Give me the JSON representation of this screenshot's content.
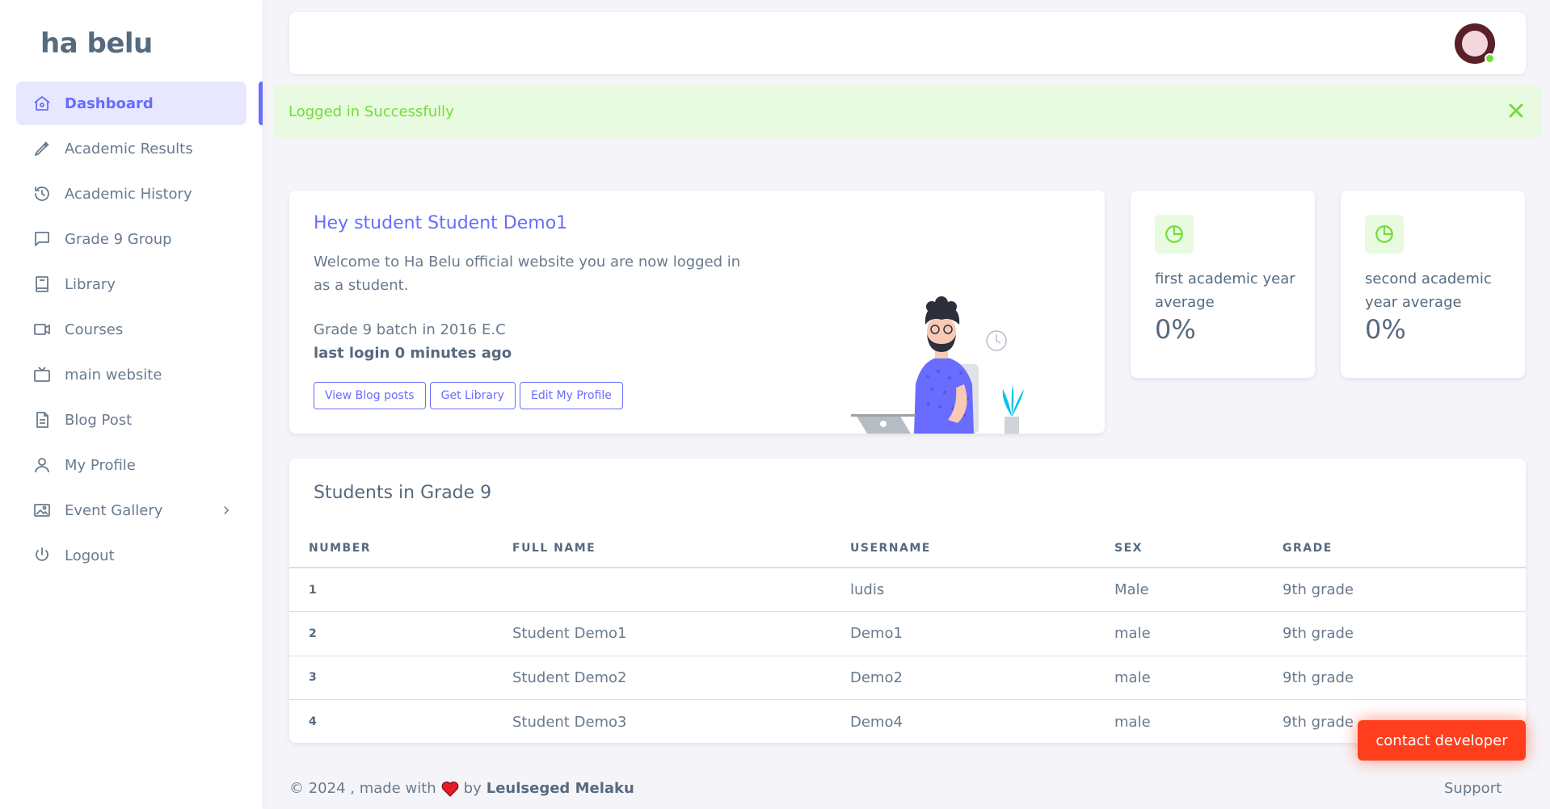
{
  "brand": "ha belu",
  "sidebar": {
    "items": [
      {
        "label": "Dashboard"
      },
      {
        "label": "Academic Results"
      },
      {
        "label": "Academic History"
      },
      {
        "label": "Grade 9 Group"
      },
      {
        "label": "Library"
      },
      {
        "label": "Courses"
      },
      {
        "label": "main website"
      },
      {
        "label": "Blog Post"
      },
      {
        "label": "My Profile"
      },
      {
        "label": "Event Gallery"
      },
      {
        "label": "Logout"
      }
    ]
  },
  "alert": {
    "text": "Logged in Successfully"
  },
  "welcome": {
    "title": "Hey student Student Demo1",
    "text": "Welcome to Ha Belu official website you are now logged in as a student.",
    "batch": "Grade 9 batch in 2016 E.C",
    "last_login": "last login 0 minutes ago",
    "buttons": [
      "View Blog posts",
      "Get Library",
      "Edit My Profile"
    ]
  },
  "stats": [
    {
      "label": "first academic year average",
      "value": "0%"
    },
    {
      "label": "second academic year average",
      "value": "0%"
    }
  ],
  "students": {
    "title": "Students in Grade 9",
    "headers": [
      "NUMBER",
      "FULL NAME",
      "USERNAME",
      "SEX",
      "GRADE"
    ],
    "rows": [
      [
        "1",
        "",
        "ludis",
        "Male",
        "9th grade"
      ],
      [
        "2",
        "Student Demo1",
        "Demo1",
        "male",
        "9th grade"
      ],
      [
        "3",
        "Student Demo2",
        "Demo2",
        "male",
        "9th grade"
      ],
      [
        "4",
        "Student Demo3",
        "Demo4",
        "male",
        "9th grade"
      ]
    ]
  },
  "footer": {
    "prefix": "© 2024 , made with",
    "by": "by",
    "author": "Leulseged Melaku",
    "support": "Support",
    "contact": "contact developer"
  },
  "colors": {
    "accent": "#696cff",
    "success": "#71dd37",
    "danger": "#ff3e1d"
  }
}
